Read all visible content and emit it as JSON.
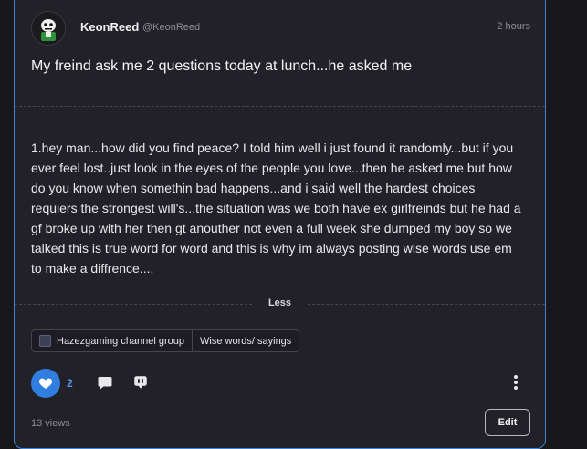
{
  "post": {
    "username": "KeonReed",
    "handle": "@KeonReed",
    "time": "2 hours",
    "title": "My freind ask me 2 questions today at lunch...he asked me",
    "body": "1.hey man...how did you find peace? I told him well i just found it randomly...but if you ever feel lost..just look in the eyes of the people you love...then he asked me but how do you know when somethin bad happens...and i said well the hardest choices requiers the strongest will's...the situation was we both have ex girlfreinds but he had a gf broke up with her then gt anouther not even a full week she dumped my boy so we talked this is true word for word and this is why im always posting wise words use em to make a diffrence....",
    "less_label": "Less",
    "tags": [
      "Hazezgaming channel group",
      "Wise words/ sayings"
    ],
    "like_count": "2",
    "views": "13 views",
    "edit_label": "Edit"
  },
  "icons": {
    "avatar": "skeleton-avatar",
    "like": "heart-icon",
    "comment": "comment-icon",
    "share": "share-icon",
    "more": "more-vertical-icon",
    "tag": "group-icon"
  },
  "colors": {
    "accent": "#2f7ee0",
    "card_border": "#3b82d6",
    "background": "#18181c",
    "card": "#222128"
  }
}
